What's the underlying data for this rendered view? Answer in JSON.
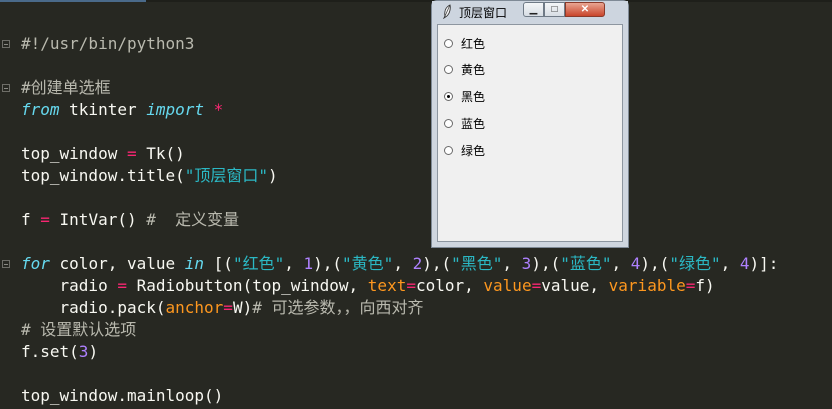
{
  "editor": {
    "lines": [
      [
        {
          "t": "#!/usr/bin/python3",
          "c": "cmt"
        }
      ],
      [],
      [
        {
          "t": "#创建单选框",
          "c": "cmt"
        }
      ],
      [
        {
          "t": "from",
          "c": "kw"
        },
        {
          "t": " tkinter "
        },
        {
          "t": "import",
          "c": "kw"
        },
        {
          "t": " "
        },
        {
          "t": "*",
          "c": "op"
        }
      ],
      [],
      [
        {
          "t": "top_window "
        },
        {
          "t": "=",
          "c": "op"
        },
        {
          "t": " Tk()"
        }
      ],
      [
        {
          "t": "top_window.title("
        },
        {
          "t": "\"顶层窗口\"",
          "c": "str"
        },
        {
          "t": ")"
        }
      ],
      [],
      [
        {
          "t": "f "
        },
        {
          "t": "=",
          "c": "op"
        },
        {
          "t": " IntVar() "
        },
        {
          "t": "#  定义变量",
          "c": "cmt"
        }
      ],
      [],
      [
        {
          "t": "for",
          "c": "kw"
        },
        {
          "t": " color, value "
        },
        {
          "t": "in",
          "c": "kw"
        },
        {
          "t": " [("
        },
        {
          "t": "\"红色\"",
          "c": "str"
        },
        {
          "t": ", "
        },
        {
          "t": "1",
          "c": "num"
        },
        {
          "t": "),("
        },
        {
          "t": "\"黄色\"",
          "c": "str"
        },
        {
          "t": ", "
        },
        {
          "t": "2",
          "c": "num"
        },
        {
          "t": "),("
        },
        {
          "t": "\"黑色\"",
          "c": "str"
        },
        {
          "t": ", "
        },
        {
          "t": "3",
          "c": "num"
        },
        {
          "t": "),("
        },
        {
          "t": "\"蓝色\"",
          "c": "str"
        },
        {
          "t": ", "
        },
        {
          "t": "4",
          "c": "num"
        },
        {
          "t": "),("
        },
        {
          "t": "\"绿色\"",
          "c": "str"
        },
        {
          "t": ", "
        },
        {
          "t": "4",
          "c": "num"
        },
        {
          "t": ")]:"
        }
      ],
      [
        {
          "t": "    radio "
        },
        {
          "t": "=",
          "c": "op"
        },
        {
          "t": " Radiobutton(top_window, "
        },
        {
          "t": "text",
          "c": "param"
        },
        {
          "t": "=",
          "c": "op"
        },
        {
          "t": "color, "
        },
        {
          "t": "value",
          "c": "param"
        },
        {
          "t": "=",
          "c": "op"
        },
        {
          "t": "value, "
        },
        {
          "t": "variable",
          "c": "param"
        },
        {
          "t": "=",
          "c": "op"
        },
        {
          "t": "f)"
        }
      ],
      [
        {
          "t": "    radio.pack("
        },
        {
          "t": "anchor",
          "c": "param"
        },
        {
          "t": "=",
          "c": "op"
        },
        {
          "t": "W)"
        },
        {
          "t": "# 可选参数，，向西对齐",
          "c": "cmt"
        }
      ],
      [
        {
          "t": "# 设置默认选项",
          "c": "cmt"
        }
      ],
      [
        {
          "t": "f.set("
        },
        {
          "t": "3",
          "c": "num"
        },
        {
          "t": ")"
        }
      ],
      [],
      [
        {
          "t": "top_window.mainloop()"
        }
      ]
    ]
  },
  "tk_window": {
    "title": "顶层窗口",
    "min_glyph": "▁",
    "max_glyph": "□",
    "close_glyph": "✕",
    "options": [
      {
        "label": "红色",
        "selected": false
      },
      {
        "label": "黄色",
        "selected": false
      },
      {
        "label": "黑色",
        "selected": true
      },
      {
        "label": "蓝色",
        "selected": false
      },
      {
        "label": "绿色",
        "selected": false
      }
    ]
  },
  "colors": {
    "editor_bg": "#272822",
    "keyword": "#66d9ef",
    "operator": "#f92672",
    "string": "#2bb8c4",
    "number": "#ae81ff",
    "comment": "#b9b9ae",
    "param": "#fd971f"
  }
}
